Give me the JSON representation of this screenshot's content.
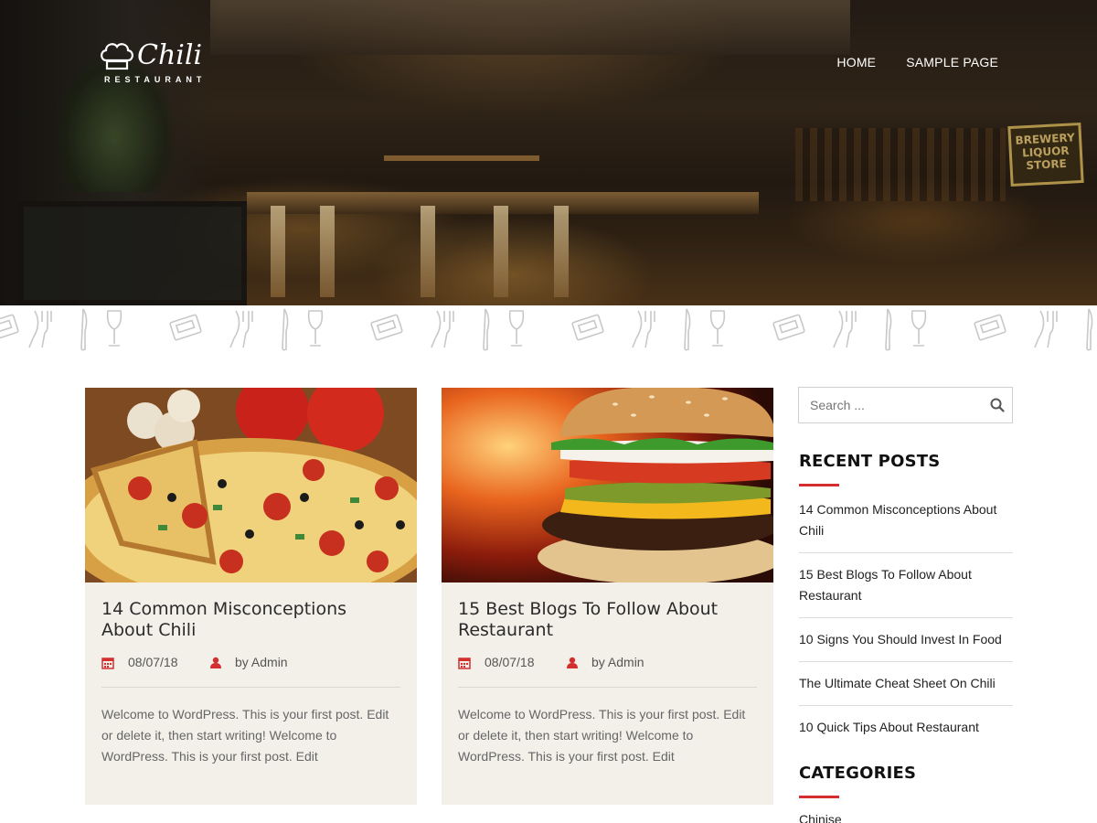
{
  "site": {
    "logo_name": "Chili",
    "logo_subtitle": "RESTAURANT",
    "hero_sign": "BREWERY LIQUOR STORE"
  },
  "nav": {
    "items": [
      {
        "label": "HOME"
      },
      {
        "label": "SAMPLE PAGE"
      }
    ]
  },
  "posts": [
    {
      "title": "14 Common Misconceptions About Chili",
      "date": "08/07/18",
      "author": "by Admin",
      "excerpt": "Welcome to WordPress. This is your first post. Edit or delete it, then start writing! Welcome to WordPress. This is your first post. Edit",
      "image": "pizza"
    },
    {
      "title": "15 Best Blogs To Follow About Restaurant",
      "date": "08/07/18",
      "author": "by Admin",
      "excerpt": "Welcome to WordPress. This is your first post. Edit or delete it, then start writing! Welcome to WordPress. This is your first post. Edit",
      "image": "burger"
    }
  ],
  "sidebar": {
    "search_placeholder": "Search ...",
    "recent_title": "RECENT POSTS",
    "recent_posts": [
      {
        "label": "14 Common Misconceptions About Chili"
      },
      {
        "label": "15 Best Blogs To Follow About Restaurant"
      },
      {
        "label": "10 Signs You Should Invest In Food"
      },
      {
        "label": "The Ultimate Cheat Sheet On Chili"
      },
      {
        "label": "10 Quick Tips About Restaurant"
      }
    ],
    "categories_title": "CATEGORIES",
    "categories": [
      {
        "label": "Chinise"
      }
    ]
  },
  "colors": {
    "accent": "#d32f2f",
    "card_bg": "#f3f0ea"
  }
}
